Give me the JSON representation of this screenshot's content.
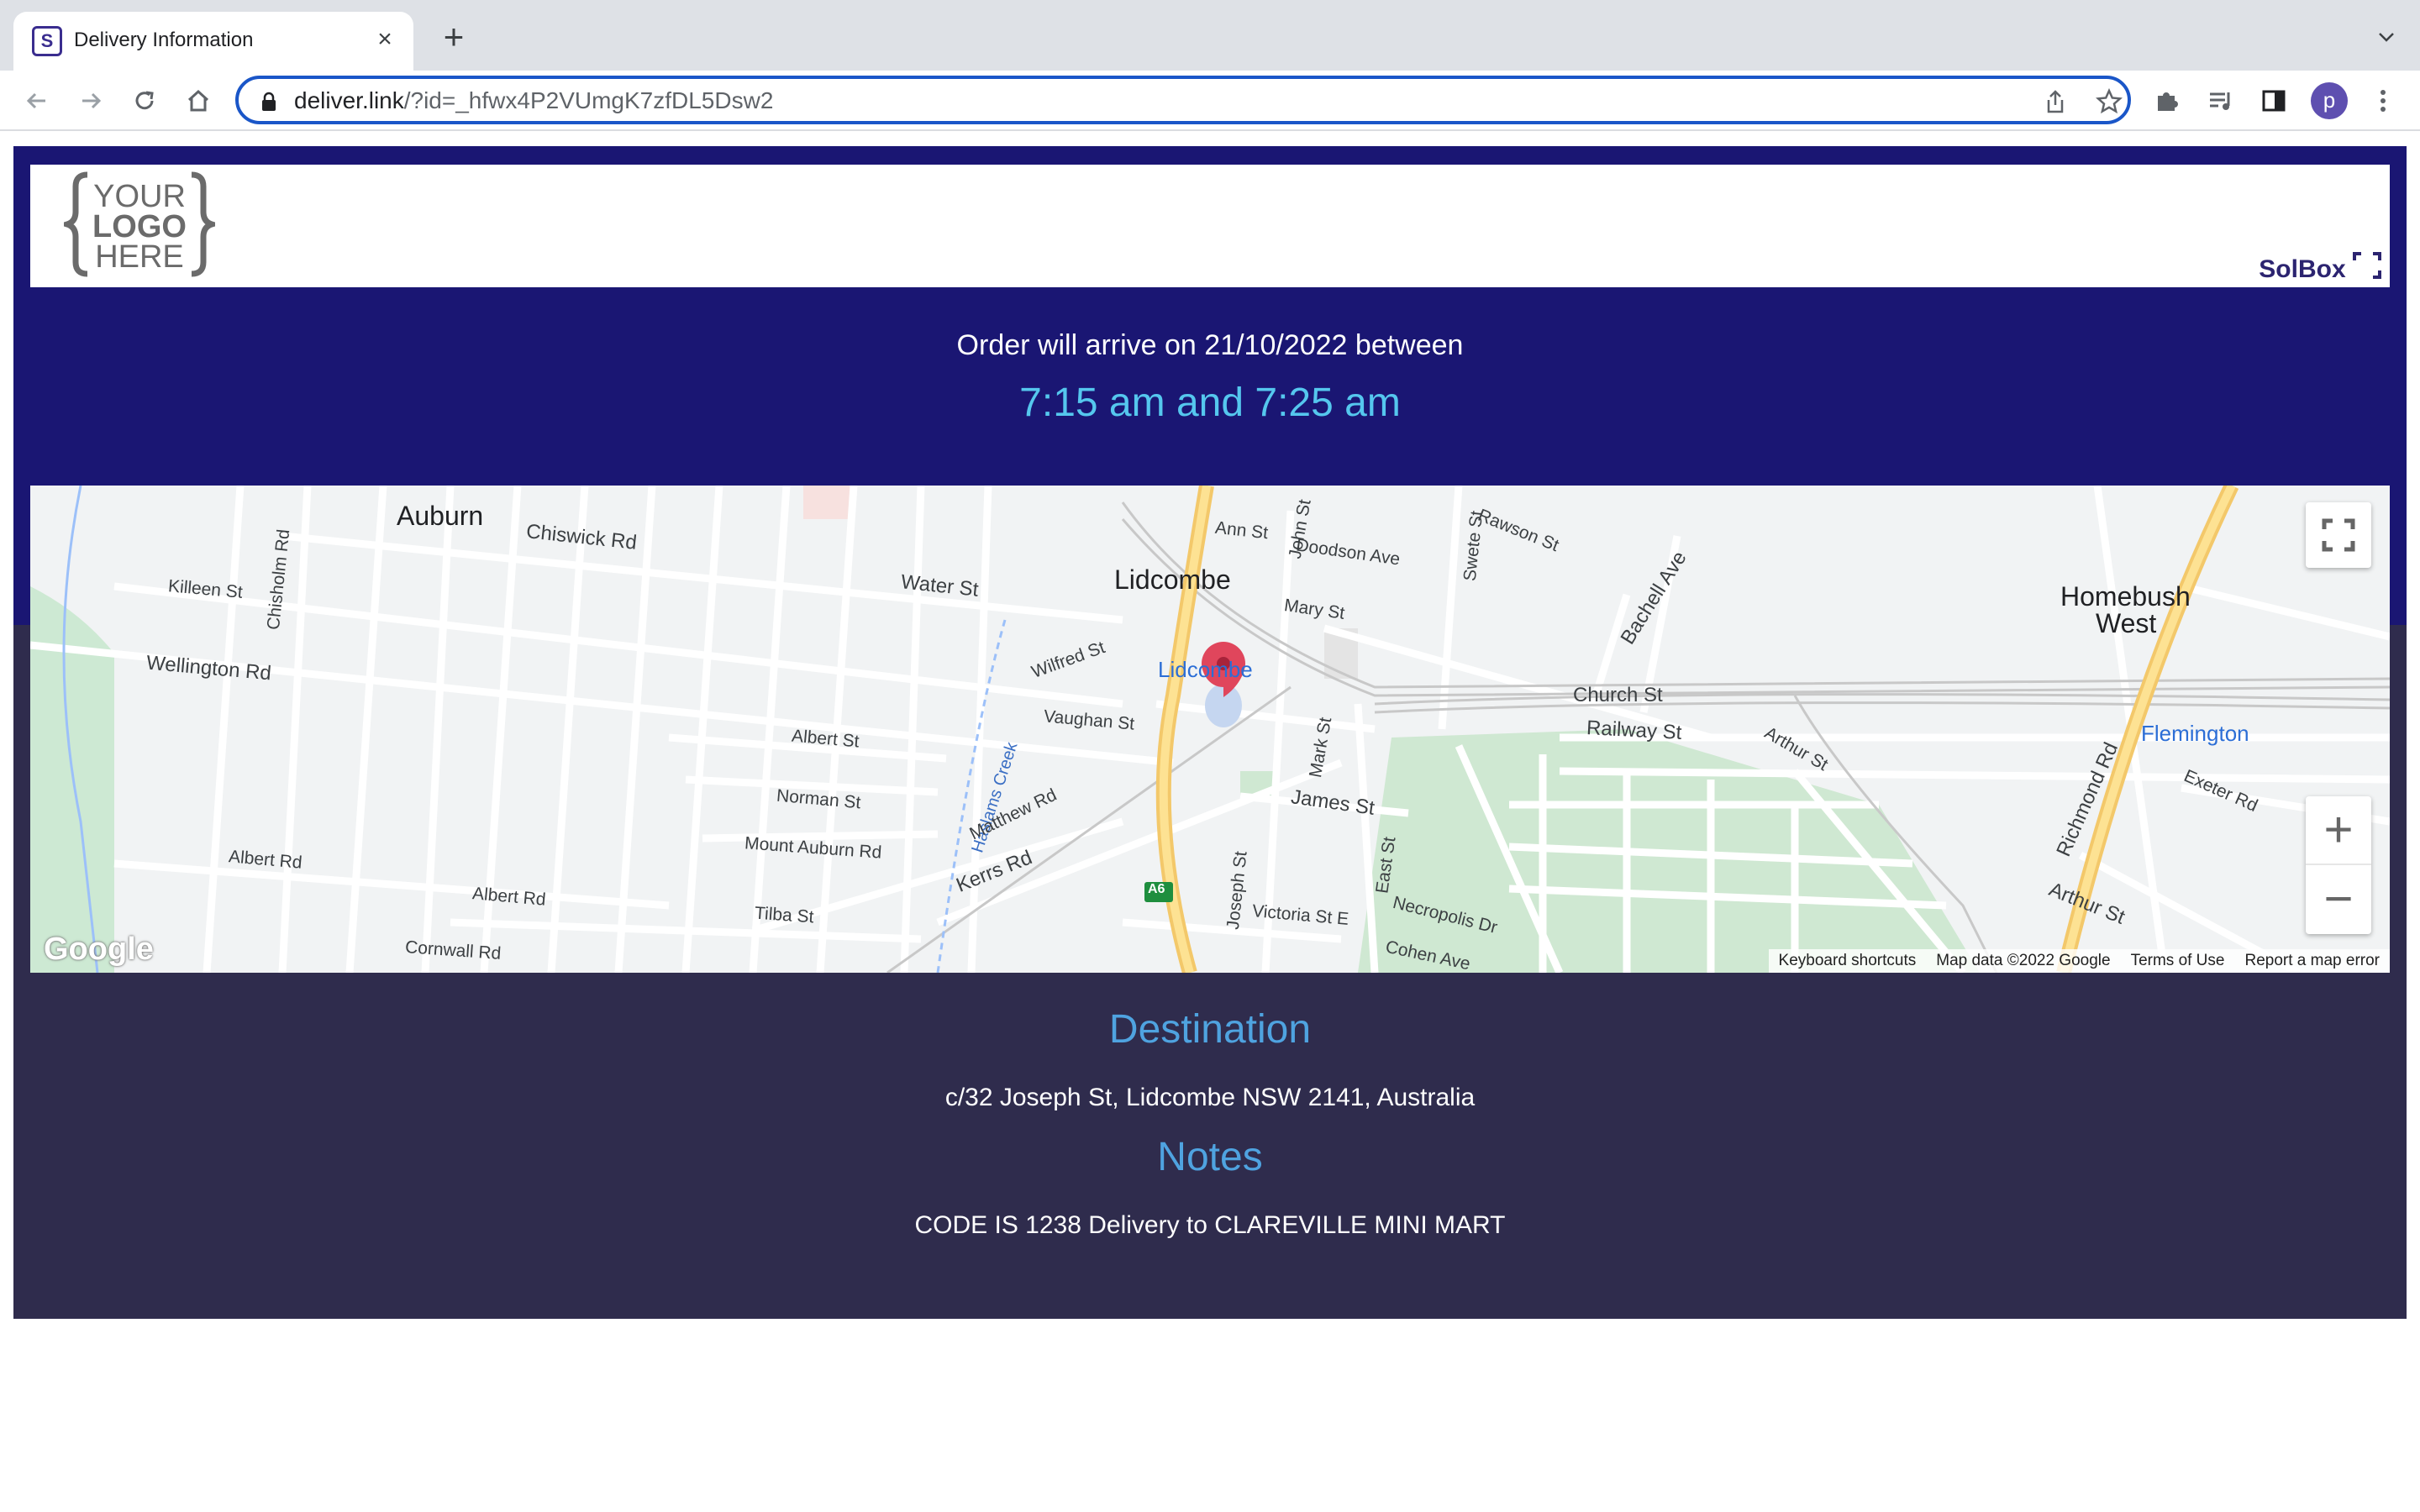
{
  "browser": {
    "tab_title": "Delivery Information",
    "favicon_letter": "S",
    "url_domain": "deliver.link",
    "url_rest": "/?id=_hfwx4P2VUmgK7zfDL5Dsw2",
    "profile_initial": "p"
  },
  "header": {
    "logo_lines": [
      "YOUR",
      "LOGO",
      "HERE"
    ],
    "brand": "SolBox"
  },
  "delivery": {
    "arrive_text": "Order will arrive on 21/10/2022 between",
    "window_text": "7:15 am and 7:25 am"
  },
  "map": {
    "place_labels": {
      "auburn": "Auburn",
      "lidcombe": "Lidcombe",
      "homebush": "Homebush",
      "west": "West",
      "lidcombe_station": "Lidcombe",
      "flemington": "Flemington",
      "haslams_creek": "Haslams Creek"
    },
    "street_labels": {
      "wellington": "Wellington Rd",
      "chiswick": "Chiswick Rd",
      "water": "Water St",
      "killeen": "Killeen St",
      "chisholm": "Chisholm Rd",
      "albert_st": "Albert St",
      "norman": "Norman St",
      "mount_auburn": "Mount Auburn Rd",
      "albert_rd": "Albert Rd",
      "albert_rd2": "Albert Rd",
      "cornwall": "Cornwall Rd",
      "tilba": "Tilba St",
      "kerrs": "Kerrs Rd",
      "matthew": "Matthew Rd",
      "vaughan": "Vaughan St",
      "wilfred": "Wilfred St",
      "james": "James St",
      "church": "Church St",
      "railway": "Railway St",
      "arthur": "Arthur St",
      "arthur2": "Arthur St",
      "victoria": "Victoria St E",
      "east": "East St",
      "necropolis": "Necropolis Dr",
      "cohen": "Cohen Ave",
      "john": "John St",
      "mary": "Mary St",
      "doodson": "Doodson Ave",
      "ann": "Ann St",
      "swete": "Swete St",
      "bachell": "Bachell Ave",
      "rawson": "Rawson St",
      "richmond": "Richmond Rd",
      "exeter": "Exeter Rd",
      "joseph": "Joseph St",
      "mark": "Mark St",
      "a6": "A6"
    },
    "fullscreen_icon": "fullscreen-icon",
    "zoom_in": "+",
    "zoom_out": "−",
    "google": "Google",
    "attribution": [
      "Keyboard shortcuts",
      "Map data ©2022 Google",
      "Terms of Use",
      "Report a map error"
    ]
  },
  "details": {
    "destination_heading": "Destination",
    "destination": "c/32 Joseph St, Lidcombe NSW 2141, Australia",
    "notes_heading": "Notes",
    "notes": "CODE IS 1238 Delivery to CLAREVILLE MINI MART"
  }
}
